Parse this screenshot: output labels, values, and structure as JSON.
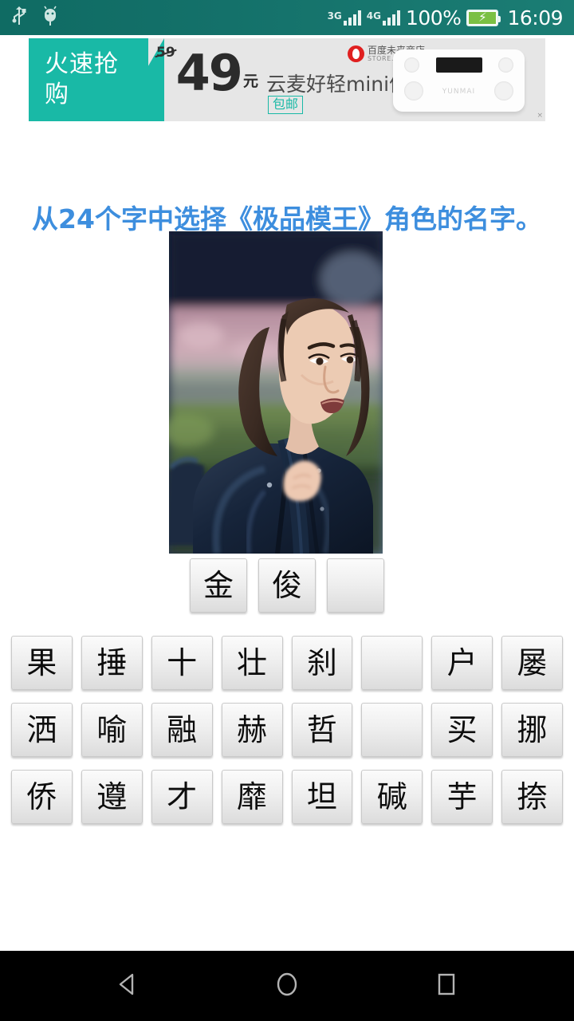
{
  "status_bar": {
    "usb_icon": "usb-icon",
    "android_debug_icon": "android-debug-icon",
    "sim1_label": "3G",
    "sim2_label": "4G",
    "battery_percent": "100%",
    "battery_icon": "battery-charging-icon",
    "time": "16:09",
    "background_color": "#14716a"
  },
  "ad": {
    "flash_sale_label": "火速抢购",
    "old_price": "59",
    "new_price": "49",
    "currency_unit": "元",
    "free_shipping_label": "包邮",
    "product_name": "云麦好轻mini体脂秤",
    "brand_cn": "百度未来商店",
    "brand_en": "STORE.BAIDU.COM",
    "brand_logo_icon": "baidu-paw-logo-icon",
    "product_image_alt": "body-fat-scale-image",
    "close_label": "×",
    "accent_color": "#19b9a6",
    "background_color": "#e6e6e6"
  },
  "question": {
    "title": "从24个字中选择《极品模王》角色的名字。",
    "title_color": "#3d8ede",
    "photo_alt": "long-haired-man-in-leather-jacket-photo"
  },
  "answer_slots": [
    "金",
    "俊",
    ""
  ],
  "character_grid": {
    "rows": [
      [
        "果",
        "捶",
        "十",
        "壮",
        "刹",
        "",
        "户",
        "屡"
      ],
      [
        "洒",
        "喻",
        "融",
        "赫",
        "哲",
        "",
        "买",
        "挪"
      ],
      [
        "侨",
        "遵",
        "才",
        "靡",
        "坦",
        "碱",
        "芋",
        "捺"
      ]
    ]
  },
  "nav_bar": {
    "back_icon": "back-triangle-icon",
    "home_icon": "home-circle-icon",
    "recents_icon": "recents-square-icon",
    "background_color": "#000000"
  }
}
